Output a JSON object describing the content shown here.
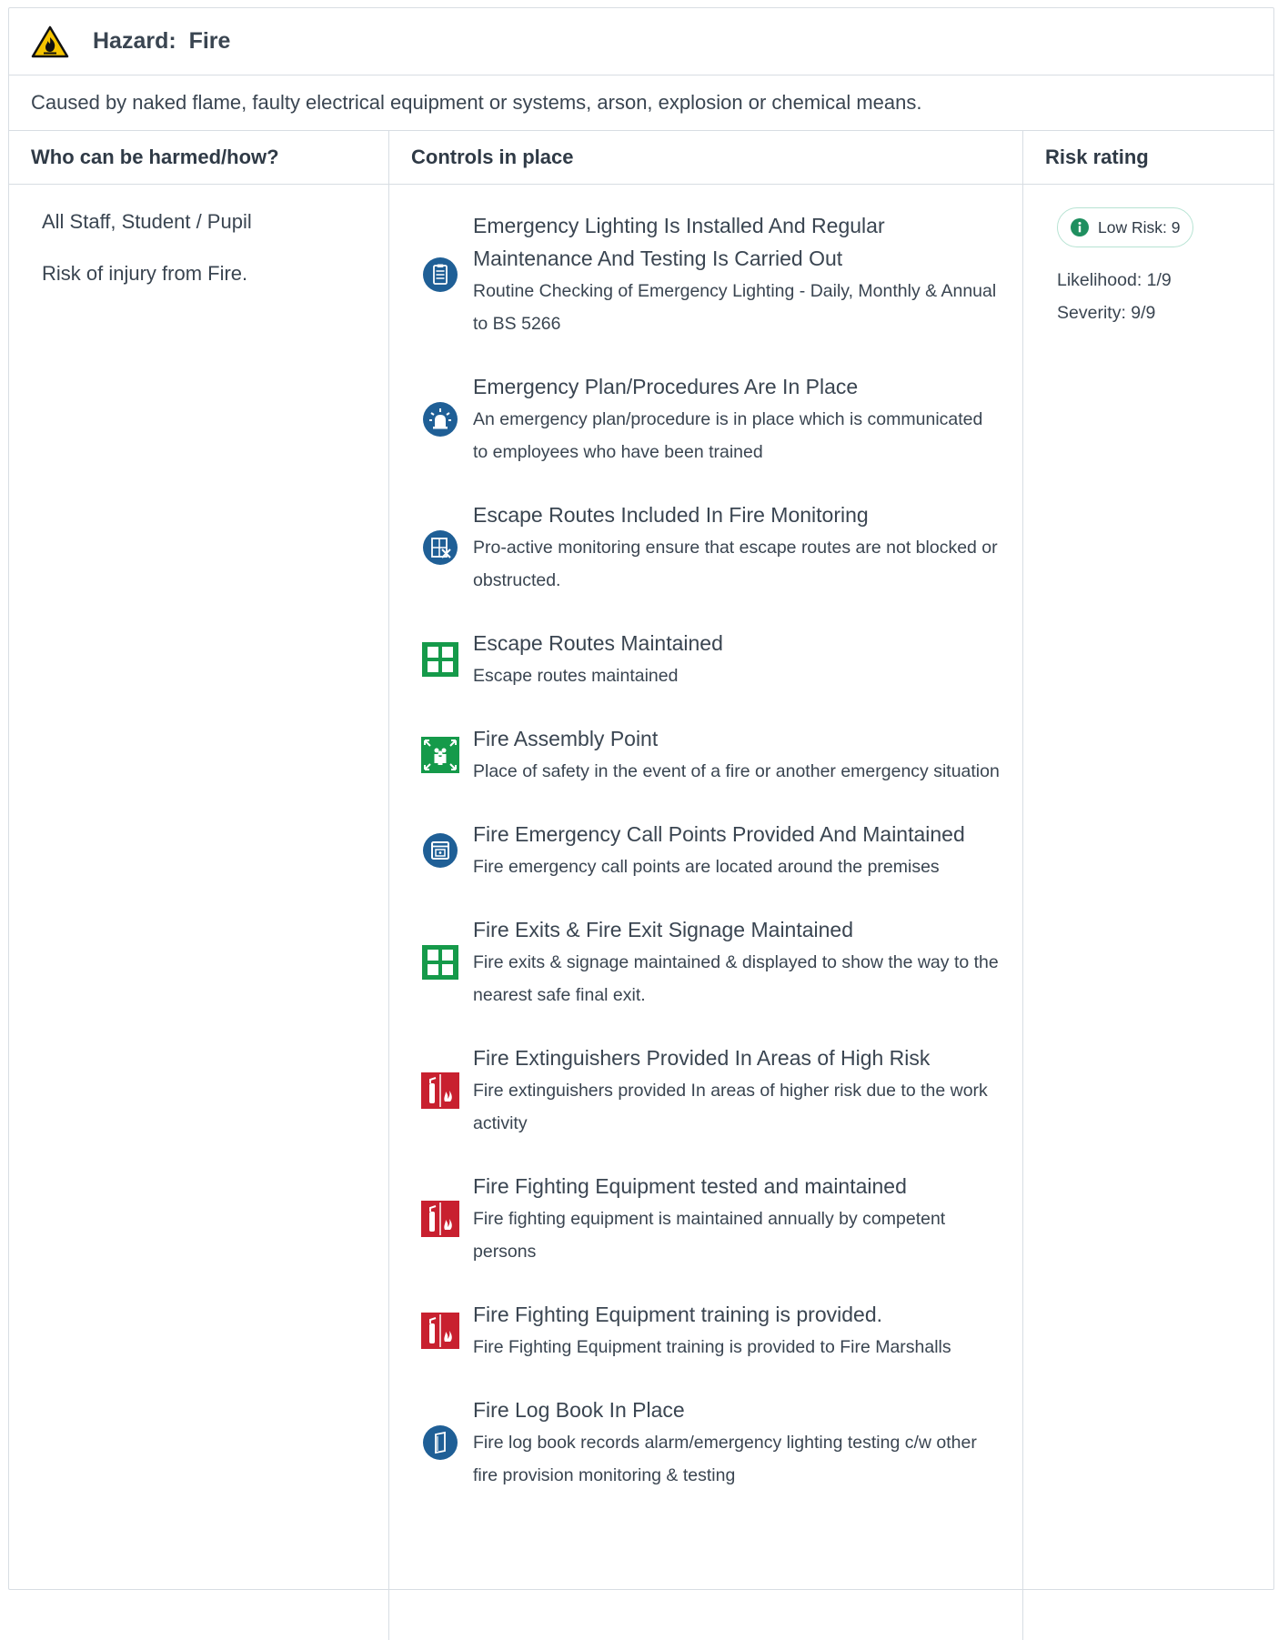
{
  "hazard": {
    "label": "Hazard:",
    "name": "Fire",
    "description": "Caused by naked flame, faulty electrical equipment or systems, arson, explosion or chemical means."
  },
  "columns": {
    "who": "Who can be harmed/how?",
    "controls": "Controls in place",
    "risk": "Risk rating"
  },
  "who": {
    "groups": "All Staff, Student / Pupil",
    "risk": "Risk of injury from Fire."
  },
  "controls": [
    {
      "icon": "clipboard-icon",
      "title": "Emergency Lighting Is Installed And Regular Maintenance And Testing Is Carried Out",
      "desc": "Routine Checking of Emergency Lighting - Daily, Monthly & Annual to BS 5266"
    },
    {
      "icon": "siren-icon",
      "title": "Emergency Plan/Procedures Are In Place",
      "desc": "An emergency plan/procedure is in place which is communicated to employees who have been trained"
    },
    {
      "icon": "blocked-route-icon",
      "title": "Escape Routes Included In Fire Monitoring",
      "desc": "Pro-active monitoring ensure that escape routes are not blocked or obstructed."
    },
    {
      "icon": "exit-door-icon",
      "title": "Escape Routes Maintained",
      "desc": "Escape routes maintained"
    },
    {
      "icon": "assembly-point-icon",
      "title": "Fire Assembly Point",
      "desc": "Place of safety in the event of a fire or another emergency situation"
    },
    {
      "icon": "call-point-icon",
      "title": "Fire Emergency Call Points Provided And Maintained",
      "desc": "Fire emergency call points are located around the premises"
    },
    {
      "icon": "fire-exit-icon",
      "title": "Fire Exits & Fire Exit Signage Maintained",
      "desc": "Fire exits & signage maintained & displayed to show the way to the nearest safe final exit."
    },
    {
      "icon": "fire-extinguisher-icon",
      "title": "Fire Extinguishers Provided In Areas of High Risk",
      "desc": "Fire extinguishers provided In areas of higher risk due to the work activity"
    },
    {
      "icon": "fire-extinguisher-icon",
      "title": "Fire Fighting Equipment tested and maintained",
      "desc": "Fire fighting equipment is maintained annually by competent persons"
    },
    {
      "icon": "fire-extinguisher-icon",
      "title": "Fire Fighting Equipment training is provided.",
      "desc": "Fire Fighting Equipment training is provided to Fire Marshalls"
    },
    {
      "icon": "log-book-icon",
      "title": "Fire Log Book In Place",
      "desc": "Fire log book records alarm/emergency lighting testing c/w other fire provision monitoring & testing"
    }
  ],
  "risk": {
    "badge": "Low Risk: 9",
    "likelihood": "Likelihood: 1/9",
    "severity": "Severity: 9/9"
  },
  "colors": {
    "border": "#d8dde3",
    "icon_blue": "#1f5f96",
    "icon_green": "#159a4a",
    "icon_red": "#c8202f",
    "badge_green": "#1f8f5f",
    "hazard_yellow": "#f5c400"
  }
}
